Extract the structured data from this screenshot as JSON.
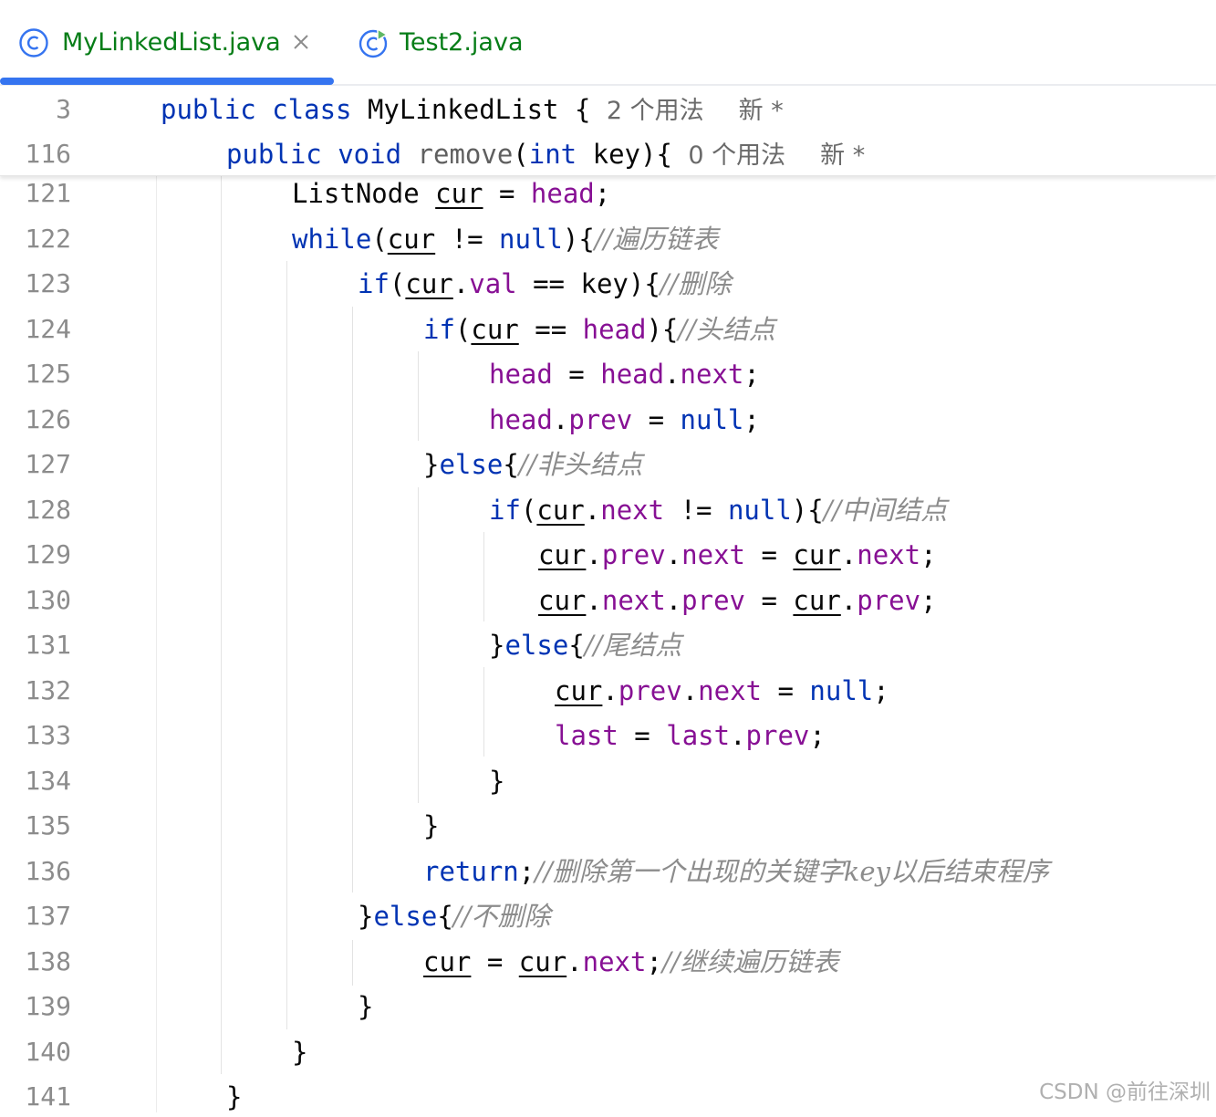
{
  "tabs": [
    {
      "label": "MyLinkedList.java",
      "icon": "java-class-icon",
      "active": true,
      "closable": true
    },
    {
      "label": "Test2.java",
      "icon": "java-runnable-class-icon",
      "active": false
    }
  ],
  "colors": {
    "keyword": "#0033b3",
    "field": "#871094",
    "method": "#00627a",
    "comment": "#8c8c8c",
    "line_number": "#8c8c8c",
    "tab_text": "#067d17",
    "active_tab_underline": "#3574f0"
  },
  "sticky_lines": [
    {
      "num": "3",
      "hint_usages": "2 个用法",
      "hint_new": "新 *"
    },
    {
      "num": "116",
      "hint_usages": "0 个用法",
      "hint_new": "新 *"
    }
  ],
  "code_lines": [
    {
      "num": "121"
    },
    {
      "num": "122",
      "comment": "//遍历链表"
    },
    {
      "num": "123",
      "comment": "//删除"
    },
    {
      "num": "124",
      "comment": "//头结点"
    },
    {
      "num": "125"
    },
    {
      "num": "126"
    },
    {
      "num": "127",
      "comment": "//非头结点"
    },
    {
      "num": "128",
      "comment": "//中间结点"
    },
    {
      "num": "129"
    },
    {
      "num": "130"
    },
    {
      "num": "131",
      "comment": "//尾结点"
    },
    {
      "num": "132"
    },
    {
      "num": "133"
    },
    {
      "num": "134"
    },
    {
      "num": "135"
    },
    {
      "num": "136",
      "comment": "//删除第一个出现的关键字key以后结束程序"
    },
    {
      "num": "137",
      "comment": "//不删除"
    },
    {
      "num": "138",
      "comment": "//继续遍历链表"
    },
    {
      "num": "139"
    },
    {
      "num": "140"
    },
    {
      "num": "141"
    }
  ],
  "watermark": "CSDN @前往深圳"
}
